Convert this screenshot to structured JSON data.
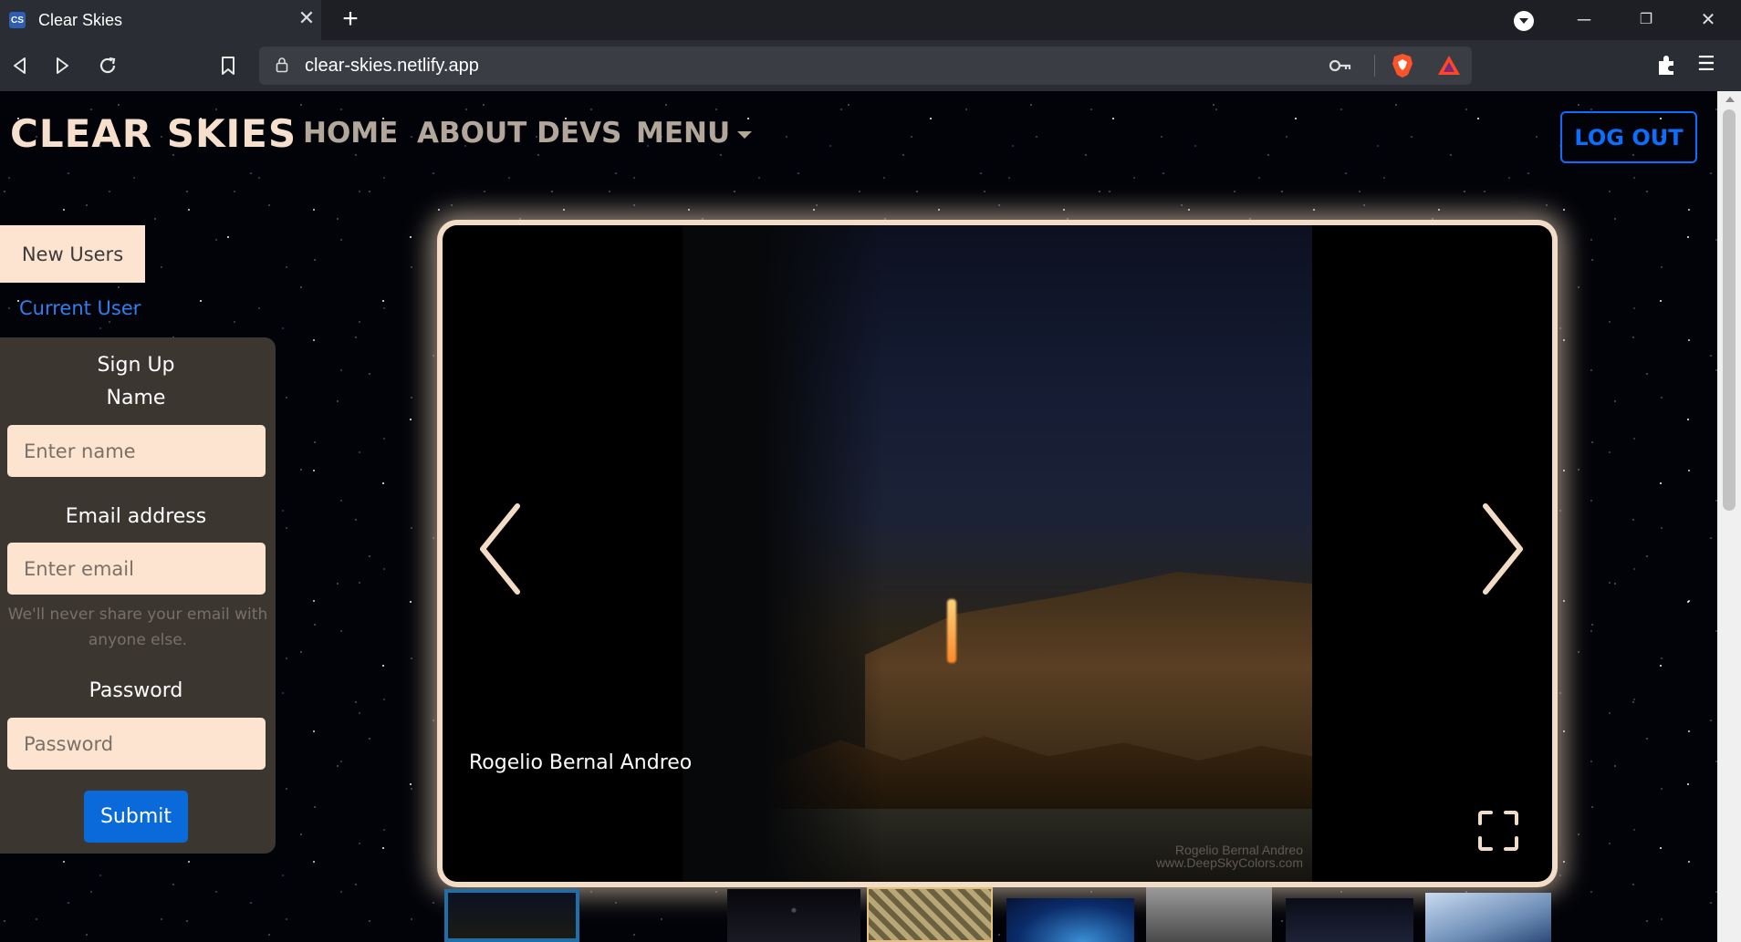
{
  "browser": {
    "tab_title": "Clear Skies",
    "tab_favicon_text": "CS",
    "url": "clear-skies.netlify.app",
    "icons": [
      "back-icon",
      "forward-icon",
      "reload-icon",
      "bookmark-icon",
      "lock-icon",
      "key-icon",
      "brave-shield-icon",
      "bat-rewards-icon",
      "extensions-icon",
      "menu-icon",
      "minimize-icon",
      "restore-icon",
      "close-icon"
    ]
  },
  "nav": {
    "brand": "CLEAR SKIES",
    "home": "HOME",
    "about": "ABOUT DEVS",
    "menu": "MENU",
    "logout": "LOG OUT"
  },
  "auth_tabs": {
    "new_users": "New Users",
    "current_user": "Current User"
  },
  "signup": {
    "title": "Sign Up",
    "name_label": "Name",
    "name_placeholder": "Enter name",
    "email_label": "Email address",
    "email_placeholder": "Enter email",
    "email_help": "We'll never share your email with anyone else.",
    "password_label": "Password",
    "password_placeholder": "Password",
    "submit": "Submit"
  },
  "carousel": {
    "caption": "Rogelio Bernal Andreo",
    "watermark_line1": "Rogelio Bernal Andreo",
    "watermark_line2": "www.DeepSkyColors.com"
  },
  "colors": {
    "brand": "#f6dfcd",
    "nav_link": "#b3a79c",
    "primary": "#0d6efd",
    "panel": "#3c3631",
    "input_bg": "#fde4d0",
    "glow": "#f2dcc6"
  }
}
